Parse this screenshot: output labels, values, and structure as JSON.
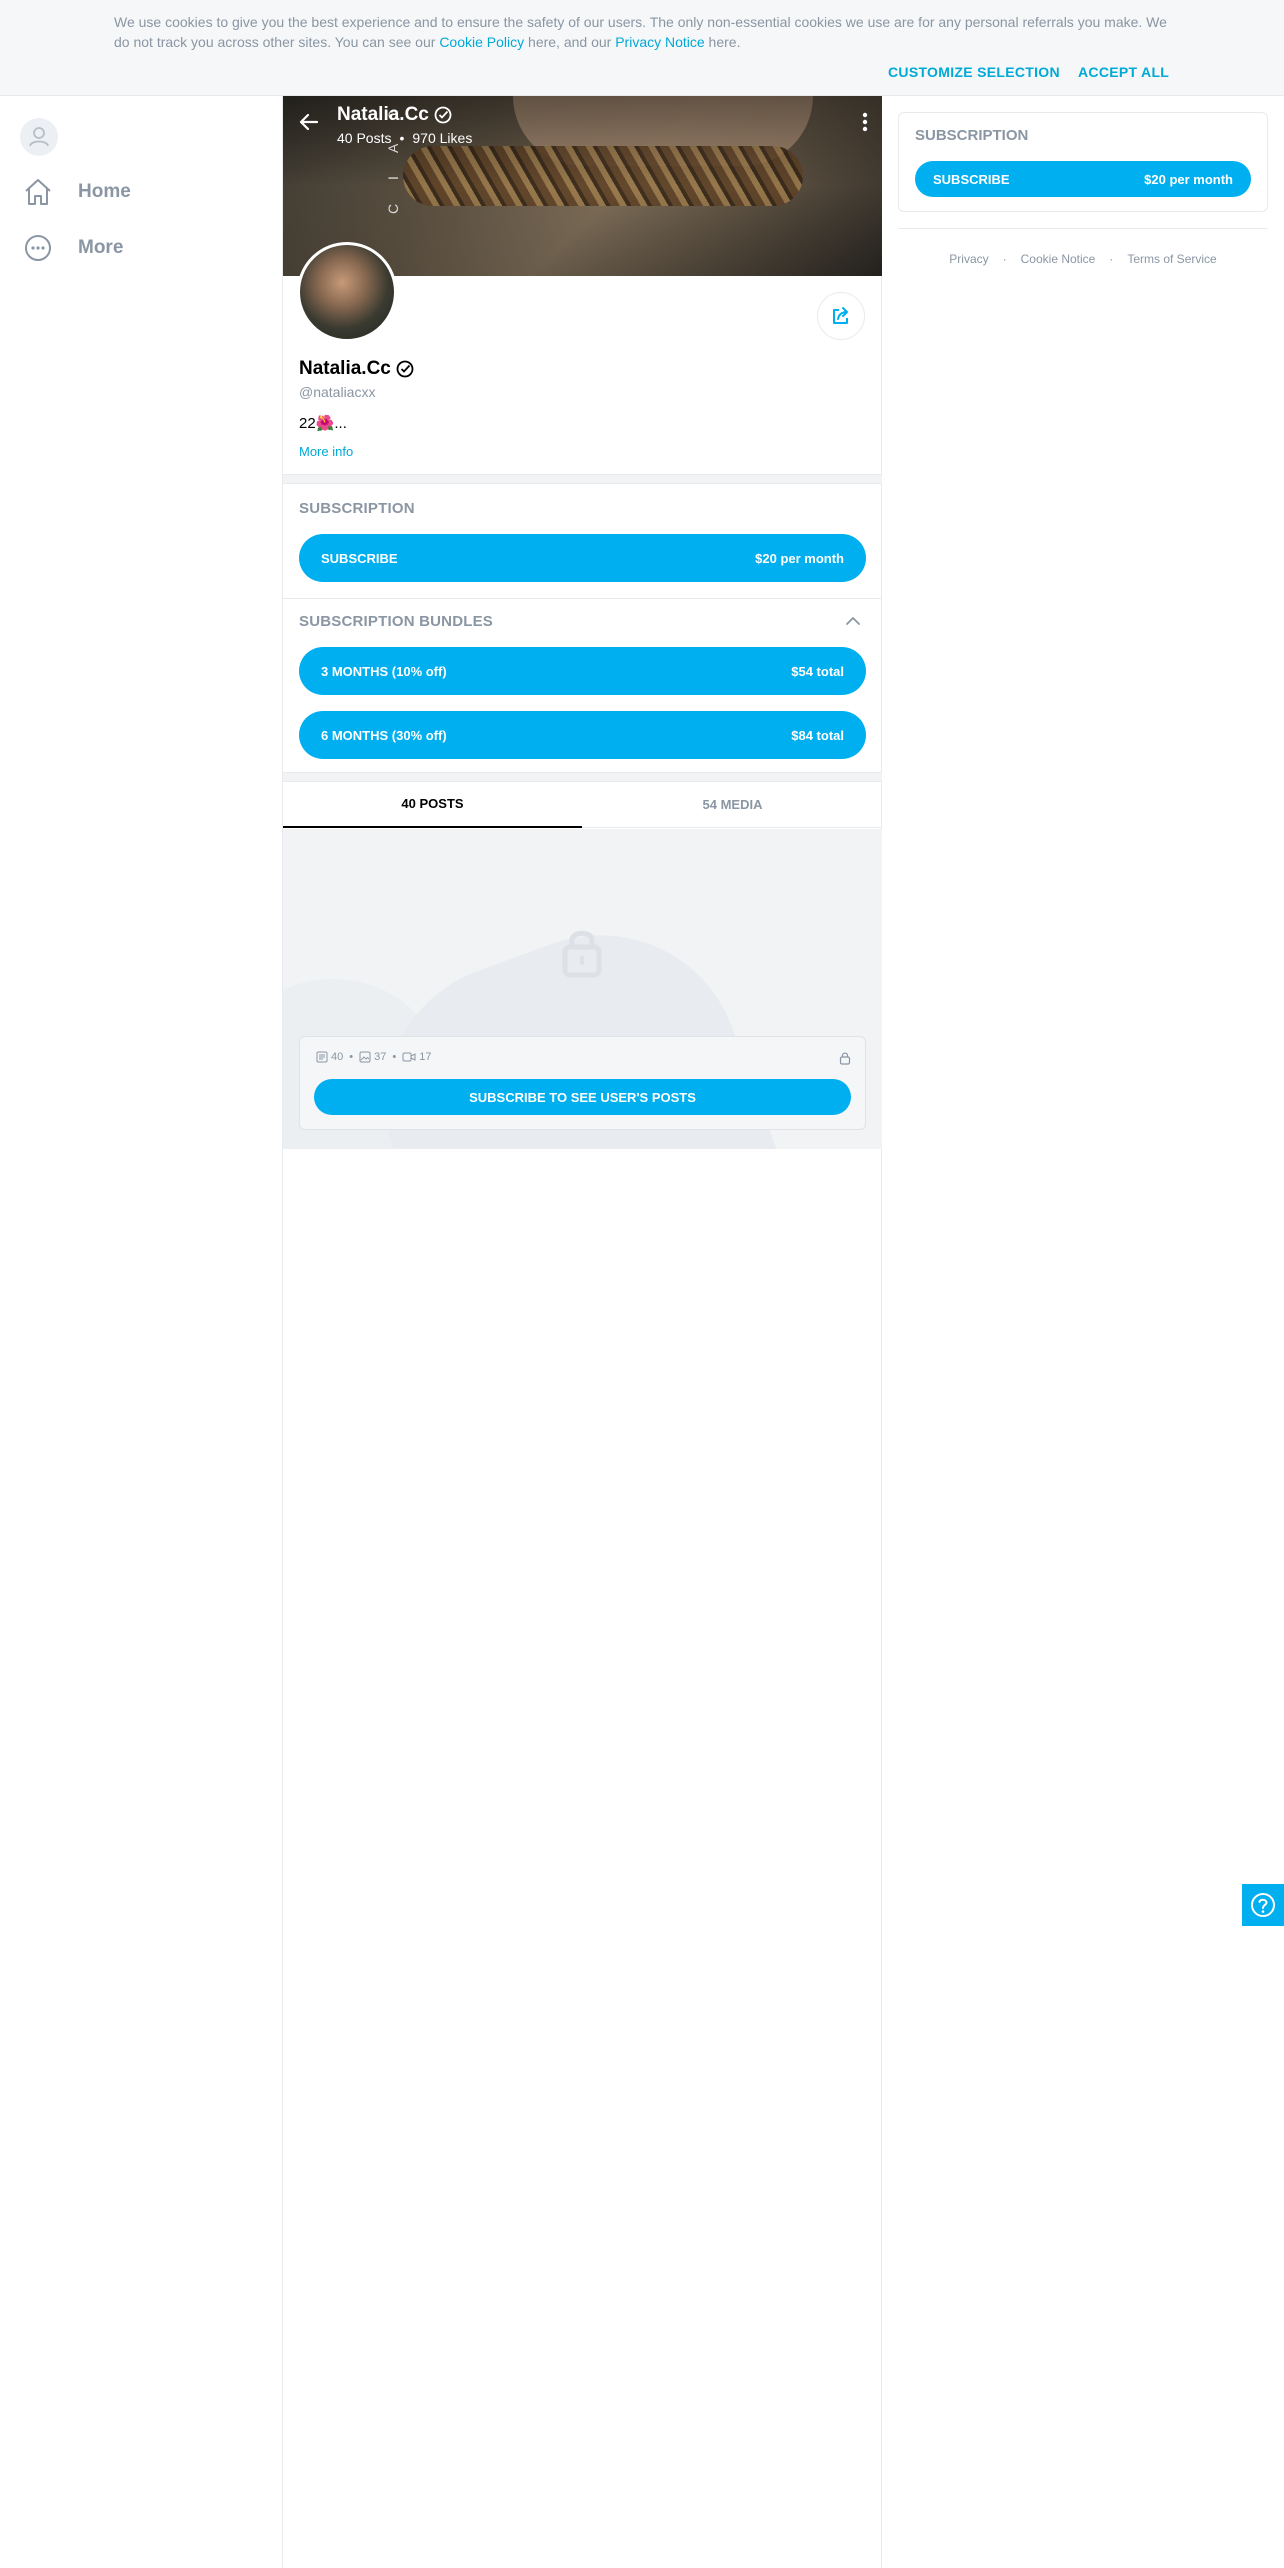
{
  "cookie_banner": {
    "text_before_policy": "We use cookies to give you the best experience and to ensure the safety of our users. The only non-essential cookies we use are for any personal referrals you make. We do not track you across other sites. You can see our ",
    "cookie_policy_link": "Cookie Policy",
    "text_between": " here, and our ",
    "privacy_notice_link": "Privacy Notice",
    "text_after": " here.",
    "customize_label": "CUSTOMIZE SELECTION",
    "accept_label": "ACCEPT ALL"
  },
  "nav": {
    "items": [
      {
        "label": "Home",
        "icon": "home-icon"
      },
      {
        "label": "More",
        "icon": "more-circle-icon"
      }
    ]
  },
  "header": {
    "name": "Natalia.Cc",
    "posts": "40 Posts",
    "likes": "970 Likes",
    "cover_text": "C I A O"
  },
  "profile": {
    "name": "Natalia.Cc",
    "handle": "@nataliacxx",
    "bio": "22🌺...",
    "more_info": "More info"
  },
  "subscription": {
    "title": "SUBSCRIPTION",
    "button_label": "SUBSCRIBE",
    "price": "$20 per month"
  },
  "bundles": {
    "title": "SUBSCRIPTION BUNDLES",
    "items": [
      {
        "label": "3 MONTHS (10% off)",
        "price": "$54 total"
      },
      {
        "label": "6 MONTHS (30% off)",
        "price": "$84 total"
      }
    ]
  },
  "tabs": {
    "posts": "40 POSTS",
    "media": "54 MEDIA"
  },
  "locked": {
    "posts_count": "40",
    "images_count": "37",
    "videos_count": "17",
    "button_label": "SUBSCRIBE TO SEE USER'S POSTS"
  },
  "sidebar_subscription": {
    "title": "SUBSCRIPTION",
    "button_label": "SUBSCRIBE",
    "price": "$20 per month"
  },
  "footer": {
    "privacy": "Privacy",
    "cookie_notice": "Cookie Notice",
    "terms": "Terms of Service"
  },
  "colors": {
    "accent": "#00aff0",
    "link": "#00a9d6",
    "muted": "#8a96a3"
  }
}
